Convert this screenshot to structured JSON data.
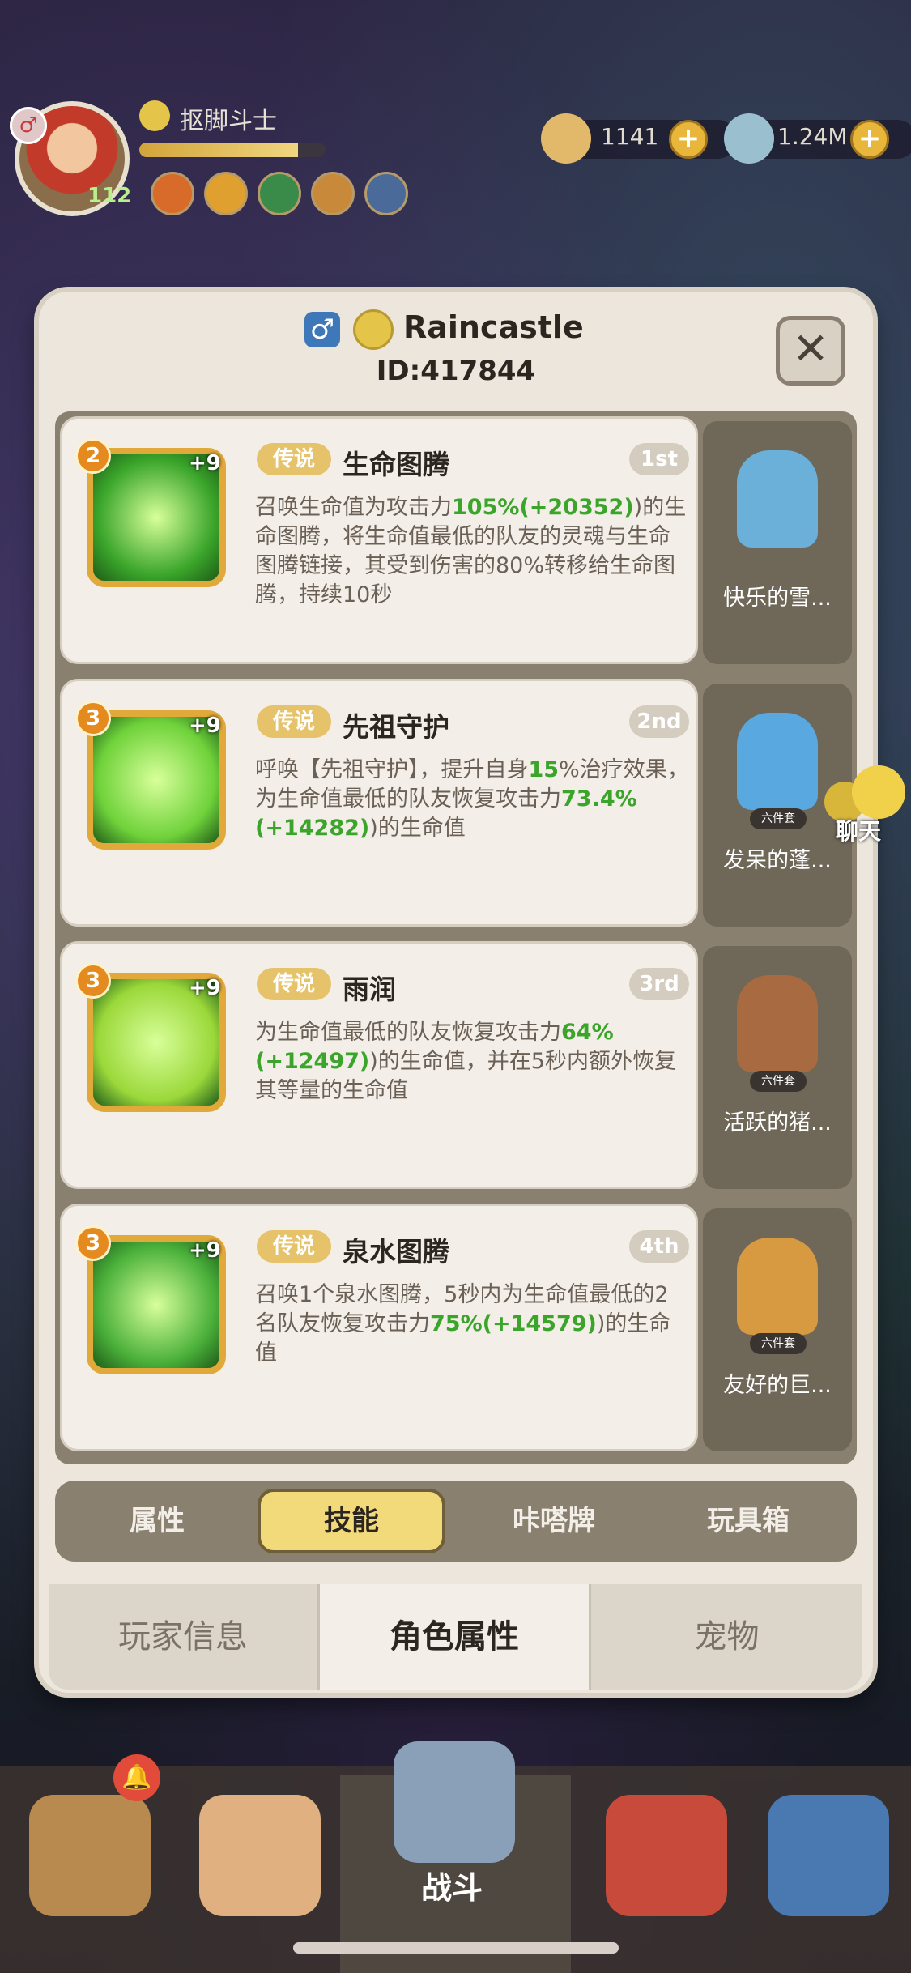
{
  "hud": {
    "player_name": "抠脚斗士",
    "level": "112",
    "xp_fraction": 0.85,
    "resources": [
      {
        "icon": "shell-icon",
        "value": "1141"
      },
      {
        "icon": "crystal-icon",
        "value": "1.24M"
      }
    ],
    "plus_label": "+"
  },
  "dialog": {
    "gender_symbol": "♂",
    "name": "Raincastle",
    "id": "ID:417844",
    "close_label": "✕"
  },
  "skills": [
    {
      "level": "2",
      "plus": "+9",
      "rarity": "传说",
      "name": "生命图腾",
      "rank": "1st",
      "desc": [
        "召唤生命值为攻击力",
        "105",
        "%(+",
        "20352",
        ")的生命图腾，将生命值最低的队友的灵魂与生命图腾链接，其受到伤害的80%转移给生命图腾，持续10秒"
      ],
      "color": "#3aa52a"
    },
    {
      "level": "3",
      "plus": "+9",
      "rarity": "传说",
      "name": "先祖守护",
      "rank": "2nd",
      "desc": [
        "呼唤【先祖守护】，提升自身",
        "15",
        "%治疗效果，为生命值最低的队友恢复攻击力",
        "73.4",
        "%(+",
        "14282",
        ")的生命值"
      ],
      "color": "#6fd23a"
    },
    {
      "level": "3",
      "plus": "+9",
      "rarity": "传说",
      "name": "雨润",
      "rank": "3rd",
      "desc": [
        "为生命值最低的队友恢复攻击力",
        "64",
        "%(+",
        "12497",
        ")的生命值，并在5秒内额外恢复其等量的生命值"
      ],
      "color": "#9bd83a"
    },
    {
      "level": "3",
      "plus": "+9",
      "rarity": "传说",
      "name": "泉水图腾",
      "rank": "4th",
      "desc": [
        "召唤1个泉水图腾，5秒内为生命值最低的2名队友恢复攻击力",
        "75",
        "%(+",
        "14579",
        ")的生命值"
      ],
      "color": "#4ab03a"
    }
  ],
  "pets": [
    {
      "name": "快乐的雪...",
      "tag": "",
      "color": "#6ab0d8"
    },
    {
      "name": "发呆的蓬...",
      "tag": "六件套",
      "color": "#5aa8e0"
    },
    {
      "name": "活跃的猪...",
      "tag": "六件套",
      "color": "#a86a40"
    },
    {
      "name": "友好的巨...",
      "tag": "六件套",
      "color": "#d89a40"
    }
  ],
  "pet_tag_first": "六件套",
  "tabs": [
    "属性",
    "技能",
    "咔嗒牌",
    "玩具箱"
  ],
  "bottom_tabs": [
    "玩家信息",
    "角色属性",
    "宠物"
  ],
  "chat_label": "聊天",
  "nav_label": "战斗"
}
